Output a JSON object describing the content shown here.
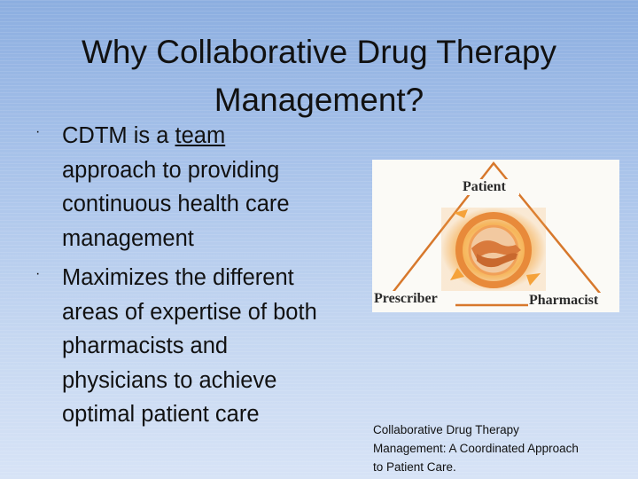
{
  "slide": {
    "title": "Why Collaborative Drug Therapy Management?",
    "bullets": [
      {
        "pre": "CDTM is a ",
        "link": "team",
        "post": " approach to providing continuous health care management"
      },
      {
        "text": "Maximizes the different areas of expertise of both pharmacists and physicians to achieve optimal patient care"
      }
    ],
    "bullet_glyph": "·"
  },
  "diagram": {
    "labels": {
      "top": "Patient",
      "left": "Prescriber",
      "right": "Pharmacist"
    },
    "colors": {
      "triangle": "#d7782c",
      "ring": "#e88a3a",
      "glow": "#f5b04a"
    },
    "icon": "handshake-icon"
  },
  "caption": "Collaborative Drug Therapy Management: A Coordinated Approach to Patient Care."
}
